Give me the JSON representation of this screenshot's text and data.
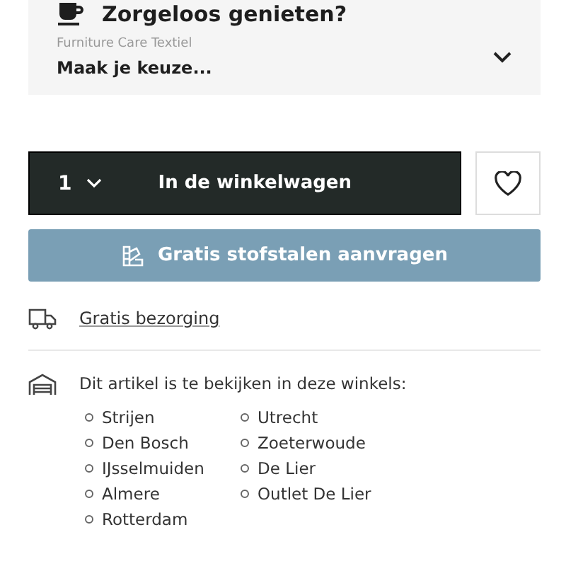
{
  "care_panel": {
    "title": "Zorgeloos genieten?",
    "select_label": "Furniture Care Textiel",
    "select_value": "Maak je keuze..."
  },
  "cart": {
    "quantity": "1",
    "button": "In de winkelwagen"
  },
  "samples_button": "Gratis stofstalen aanvragen",
  "delivery": {
    "link": "Gratis bezorging"
  },
  "stores": {
    "intro": "Dit artikel is te bekijken in deze winkels:",
    "columns": [
      [
        "Strijen",
        "Den Bosch",
        "IJsselmuiden",
        "Almere",
        "Rotterdam"
      ],
      [
        "Utrecht",
        "Zoeterwoude",
        "De Lier",
        "Outlet De Lier"
      ]
    ]
  }
}
